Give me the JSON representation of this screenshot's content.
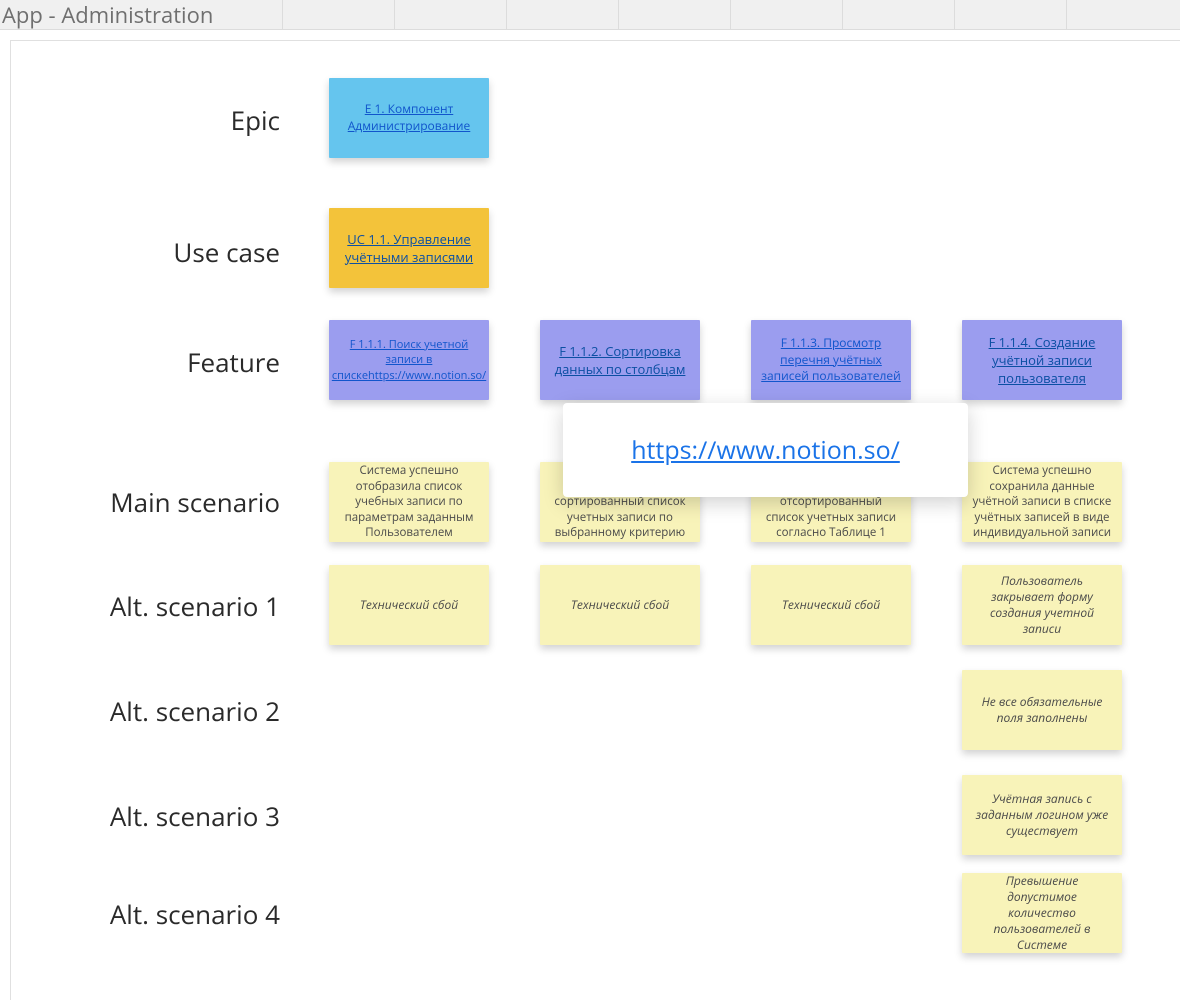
{
  "header": {
    "title": "App - Administration"
  },
  "rows": {
    "epic": "Epic",
    "usecase": "Use case",
    "feature": "Feature",
    "main": "Main scenario",
    "alt1": "Alt. scenario 1",
    "alt2": "Alt. scenario 2",
    "alt3": "Alt. scenario 3",
    "alt4": "Alt. scenario 4"
  },
  "cards": {
    "epic": "E 1. Компонент Администрирование",
    "usecase": "UC 1.1. Управление учётными записями",
    "feature1": "F 1.1.1. Поиск учетной записи в спискеhttps://www.notion.so/",
    "feature2": "F 1.1.2. Сортировка данных по столбцам",
    "feature3": "F 1.1.3. Просмотр перечня учётных записей пользователей",
    "feature4": "F 1.1.4. Создание учётной записи пользователя",
    "main1": "Система успешно отобразила список учебных записи по параметрам заданным Пользователем",
    "main2": "Система успешно отобразила сортированный список учетных записи по выбранному критерию",
    "main3": "Система успешно показала отсортированный список учетных записи согласно Таблице 1",
    "main4": "Система успешно сохранила данные учётной записи в списке учётных записей в виде индивидуальной записи",
    "alt1_1": "Технический сбой",
    "alt1_2": "Технический сбой",
    "alt1_3": "Технический сбой",
    "alt1_4": "Пользователь закрывает форму создания учетной записи",
    "alt2_4": "Не все обязательные поля заполнены",
    "alt3_4": "Учётная запись с заданным логином уже существует",
    "alt4_4": "Превышение допустимое количество пользователей в Системе"
  },
  "tooltip": {
    "url": "https://www.notion.so/"
  }
}
